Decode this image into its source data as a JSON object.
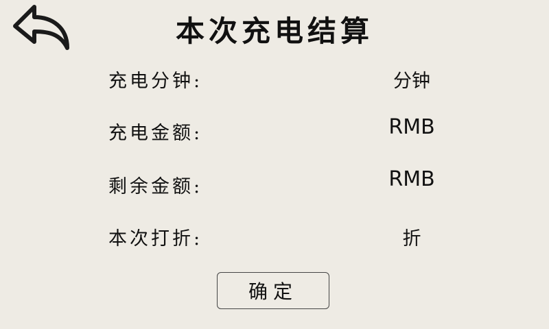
{
  "header": {
    "title": "本次充电结算",
    "back_icon": "back-arrow-icon"
  },
  "rows": [
    {
      "label": "充电分钟:",
      "value": "分钟"
    },
    {
      "label": "充电金额:",
      "value": "RMB"
    },
    {
      "label": "剩余金额:",
      "value": "RMB"
    },
    {
      "label": "本次打折:",
      "value": "折"
    }
  ],
  "actions": {
    "confirm_label": "确定"
  }
}
